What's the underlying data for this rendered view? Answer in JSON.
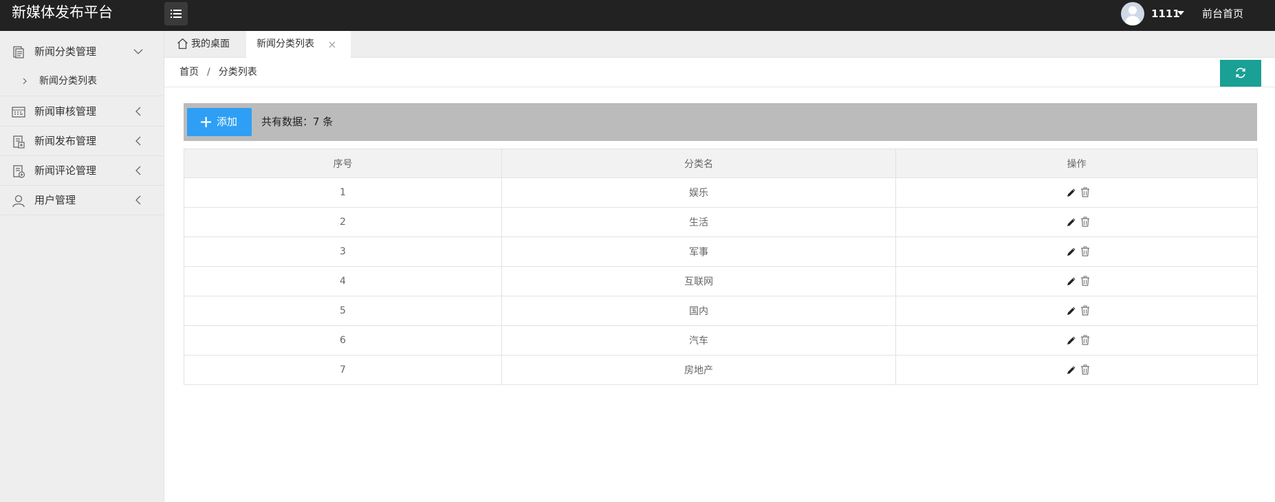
{
  "header": {
    "title": "新媒体发布平台",
    "user_name": "1111",
    "front_link": "前台首页"
  },
  "sidebar": {
    "items": [
      {
        "label": "新闻分类管理",
        "icon": "document-icon",
        "expanded": true,
        "children": [
          {
            "label": "新闻分类列表"
          }
        ]
      },
      {
        "label": "新闻审核管理",
        "icon": "grid-icon",
        "expanded": false
      },
      {
        "label": "新闻发布管理",
        "icon": "publish-icon",
        "expanded": false
      },
      {
        "label": "新闻评论管理",
        "icon": "comment-icon",
        "expanded": false
      },
      {
        "label": "用户管理",
        "icon": "user-icon",
        "expanded": false
      }
    ]
  },
  "tabs": [
    {
      "label": "我的桌面",
      "icon": "home-icon"
    },
    {
      "label": "新闻分类列表",
      "active": true
    }
  ],
  "breadcrumb": {
    "home": "首页",
    "separator": "/",
    "current": "分类列表"
  },
  "toolbar": {
    "add_label": "添加",
    "count_text": "共有数据：7 条"
  },
  "table": {
    "headers": [
      "序号",
      "分类名",
      "操作"
    ],
    "rows": [
      {
        "id": "1",
        "name": "娱乐"
      },
      {
        "id": "2",
        "name": "生活"
      },
      {
        "id": "3",
        "name": "军事"
      },
      {
        "id": "4",
        "name": "互联网"
      },
      {
        "id": "5",
        "name": "国内"
      },
      {
        "id": "6",
        "name": "汽车"
      },
      {
        "id": "7",
        "name": "房地产"
      }
    ]
  },
  "colors": {
    "header_bg": "#222222",
    "sidebar_bg": "#eeeeee",
    "accent_teal": "#1aa094",
    "add_button": "#2e9ff5",
    "toolbar_bg": "#bbbbbb"
  }
}
